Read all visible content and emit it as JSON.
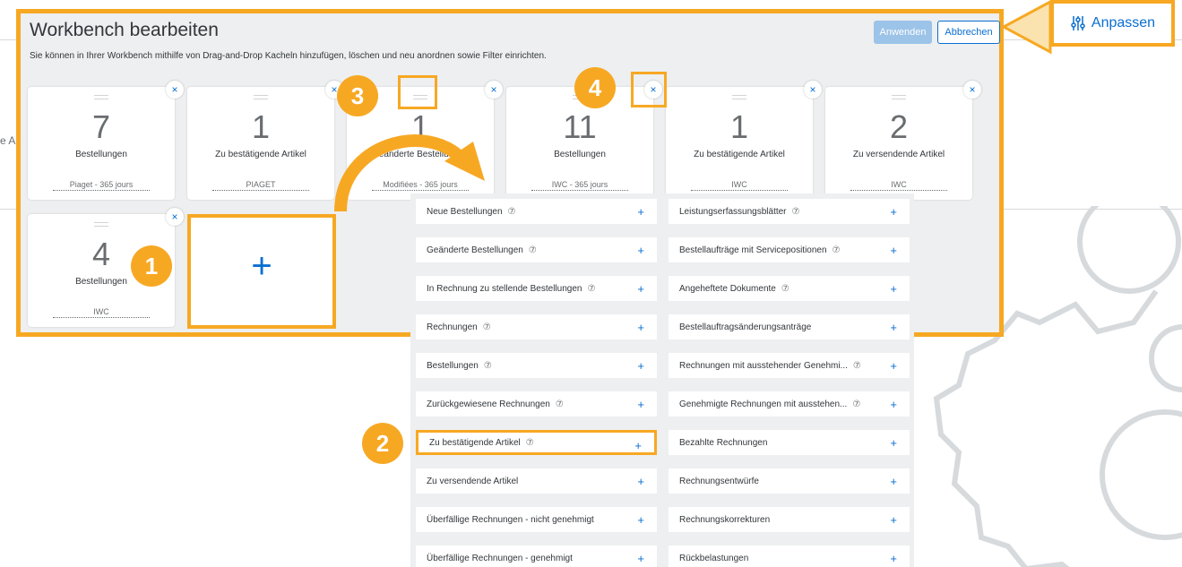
{
  "background": {
    "edge_text": "e A"
  },
  "panel": {
    "title": "Workbench bearbeiten",
    "description": "Sie können in Ihrer Workbench mithilfe von Drag-and-Drop Kacheln hinzufügen, löschen und neu anordnen sowie Filter einrichten.",
    "apply_label": "Anwenden",
    "cancel_label": "Abbrechen"
  },
  "tiles": [
    {
      "value": "7",
      "label": "Bestellungen",
      "filter": "Piaget - 365 jours"
    },
    {
      "value": "1",
      "label": "Zu bestätigende Artikel",
      "filter": "PIAGET"
    },
    {
      "value": "1",
      "label": "Geänderte Bestellungen",
      "filter": "Modifiées - 365 jours"
    },
    {
      "value": "11",
      "label": "Bestellungen",
      "filter": "IWC - 365 jours"
    },
    {
      "value": "1",
      "label": "Zu bestätigende Artikel",
      "filter": "IWC"
    },
    {
      "value": "2",
      "label": "Zu versendende Artikel",
      "filter": "IWC"
    },
    {
      "value": "4",
      "label": "Bestellungen",
      "filter": "IWC"
    }
  ],
  "add_tile": {
    "symbol": "+"
  },
  "remove_symbol": "×",
  "catalog": {
    "left": [
      {
        "label": "Neue Bestellungen",
        "help": true
      },
      {
        "label": "Geänderte Bestellungen",
        "help": true
      },
      {
        "label": "In Rechnung zu stellende Bestellungen",
        "help": true
      },
      {
        "label": "Rechnungen",
        "help": true
      },
      {
        "label": "Bestellungen",
        "help": true
      },
      {
        "label": "Zurückgewiesene Rechnungen",
        "help": true
      },
      {
        "label": "Zu bestätigende Artikel",
        "help": true
      },
      {
        "label": "Zu versendende Artikel",
        "help": false
      },
      {
        "label": "Überfällige Rechnungen - nicht genehmigt",
        "help": false
      },
      {
        "label": "Überfällige Rechnungen - genehmigt",
        "help": false
      }
    ],
    "right": [
      {
        "label": "Leistungserfassungsblätter",
        "help": true
      },
      {
        "label": "Bestellaufträge mit Servicepositionen",
        "help": true
      },
      {
        "label": "Angeheftete Dokumente",
        "help": true
      },
      {
        "label": "Bestellauftragsänderungsanträge",
        "help": false
      },
      {
        "label": "Rechnungen mit ausstehender Genehmi...",
        "help": true
      },
      {
        "label": "Genehmigte Rechnungen mit ausstehen...",
        "help": true
      },
      {
        "label": "Bezahlte Rechnungen",
        "help": false
      },
      {
        "label": "Rechnungsentwürfe",
        "help": false
      },
      {
        "label": "Rechnungskorrekturen",
        "help": false
      },
      {
        "label": "Rückbelastungen",
        "help": false
      }
    ],
    "help_symbol": "⑦",
    "plus_symbol": "+"
  },
  "callouts": [
    "1",
    "2",
    "3",
    "4"
  ],
  "anpassen": {
    "label": "Anpassen",
    "icon": "sliders-icon"
  },
  "colors": {
    "accent": "#f7a823",
    "link": "#0a6ed1",
    "panel_bg": "#edeff0"
  }
}
